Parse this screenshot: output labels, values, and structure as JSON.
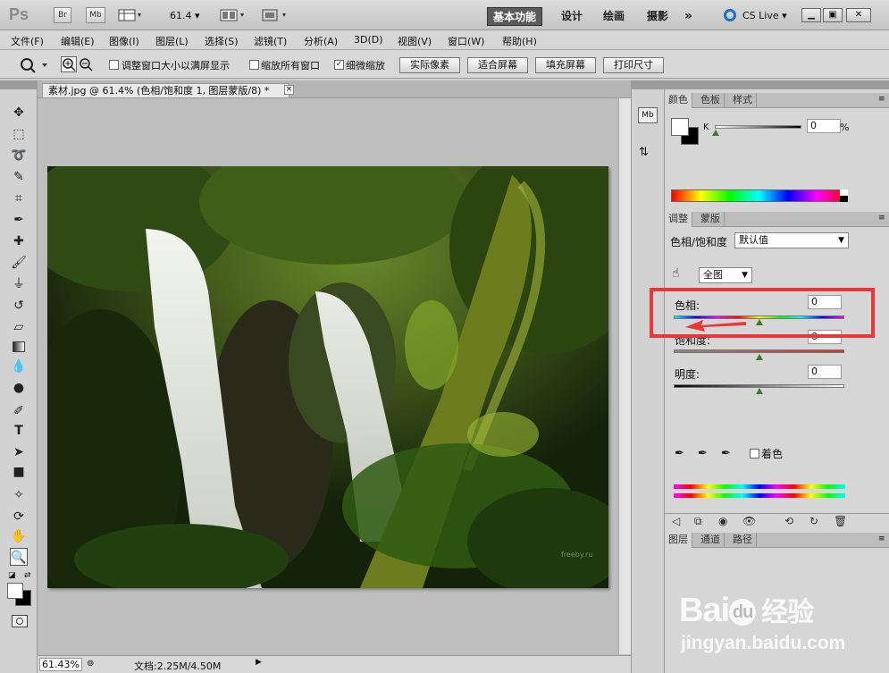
{
  "titlebar": {
    "logo": "Ps",
    "br_label": "Br",
    "mb_label": "Mb",
    "zoom_value": "61.4",
    "workspaces": [
      "基本功能",
      "设计",
      "绘画",
      "摄影"
    ],
    "more": "»",
    "cslive": "CS Live"
  },
  "menu": [
    "文件(F)",
    "编辑(E)",
    "图像(I)",
    "图层(L)",
    "选择(S)",
    "滤镜(T)",
    "分析(A)",
    "3D(D)",
    "视图(V)",
    "窗口(W)",
    "帮助(H)"
  ],
  "options": {
    "resize_windows": "调整窗口大小以满屏显示",
    "zoom_all": "缩放所有窗口",
    "scrubby_zoom": "细微缩放",
    "scrubby_checked": "✓",
    "buttons": [
      "实际像素",
      "适合屏幕",
      "填充屏幕",
      "打印尺寸"
    ]
  },
  "document": {
    "tab_title": "素材.jpg @ 61.4% (色相/饱和度 1, 图层蒙版/8) *",
    "close": "×",
    "watermark": "freeby.ru"
  },
  "status": {
    "zoom": "61.43%",
    "doc_info": "文档:2.25M/4.50M"
  },
  "dock": {
    "mb": "Mb"
  },
  "color_panel": {
    "tabs": [
      "颜色",
      "色板",
      "样式"
    ],
    "channel": "K",
    "value": "0",
    "unit": "%"
  },
  "adjust_panel": {
    "tabs": [
      "调整",
      "蒙版"
    ],
    "title": "色相/饱和度",
    "preset": "默认值",
    "channel": "全图",
    "hue_label": "色相:",
    "hue_value": "0",
    "sat_label": "饱和度:",
    "sat_value": "0",
    "light_label": "明度:",
    "light_value": "0",
    "colorize_label": "着色"
  },
  "layers_panel": {
    "tabs": [
      "图层",
      "通道",
      "路径"
    ]
  },
  "watermark": {
    "brand": "Bai",
    "paw": "du",
    "site_cn": "经验",
    "url": "jingyan.baidu.com"
  },
  "colors": {
    "annotation_red": "#e8383c",
    "ui_gray": "#d6d6d6"
  }
}
